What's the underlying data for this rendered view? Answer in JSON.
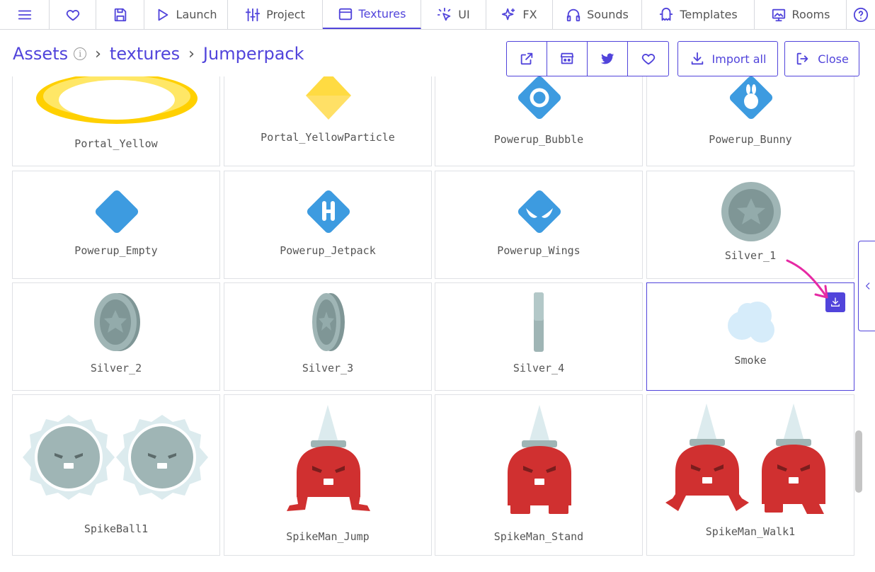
{
  "topbar": {
    "menu_icon": "hamburger-icon",
    "favorite_icon": "heart-icon",
    "save_icon": "save-icon",
    "launch_label": "Launch",
    "project_label": "Project",
    "textures_label": "Textures",
    "ui_label": "UI",
    "fx_label": "FX",
    "sounds_label": "Sounds",
    "templates_label": "Templates",
    "rooms_label": "Rooms",
    "help_icon": "question-icon",
    "active_tab": "Textures"
  },
  "breadcrumb": {
    "root": "Assets",
    "level1": "textures",
    "level2": "Jumperpack"
  },
  "toolbar": {
    "open_external_icon": "external-link-icon",
    "store_icon": "itch-store-icon",
    "twitter_icon": "twitter-icon",
    "like_icon": "heart-icon",
    "import_all_label": "Import all",
    "close_label": "Close"
  },
  "assets": [
    {
      "name": "Portal_Yellow"
    },
    {
      "name": "Portal_YellowParticle"
    },
    {
      "name": "Powerup_Bubble"
    },
    {
      "name": "Powerup_Bunny"
    },
    {
      "name": "Powerup_Empty"
    },
    {
      "name": "Powerup_Jetpack"
    },
    {
      "name": "Powerup_Wings"
    },
    {
      "name": "Silver_1"
    },
    {
      "name": "Silver_2"
    },
    {
      "name": "Silver_3"
    },
    {
      "name": "Silver_4"
    },
    {
      "name": "Smoke",
      "selected": true
    },
    {
      "name": "SpikeBall1"
    },
    {
      "name": "SpikeMan_Jump"
    },
    {
      "name": "SpikeMan_Stand"
    },
    {
      "name": "SpikeMan_Walk1"
    }
  ],
  "colors": {
    "accent": "#5144db",
    "powerup_blue": "#3d9be0",
    "silver": "#9fb5b5",
    "spike_red": "#d03030",
    "gold": "#ffd000",
    "annotation_arrow": "#e62aa4"
  }
}
